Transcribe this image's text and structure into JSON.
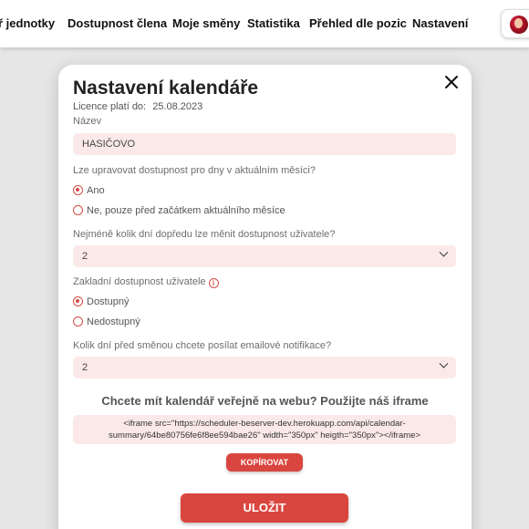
{
  "nav": {
    "items": [
      "ř jednotky",
      "Dostupnost člena",
      "Moje směny",
      "Statistika",
      "Přehled dle pozic",
      "Nastavení"
    ]
  },
  "modal": {
    "title": "Nastavení kalendáře",
    "license_label": "Licence platí do:",
    "license_date": "25.08.2023",
    "name_label": "Název",
    "name_value": "HASIČOVO",
    "q_current_month": "Lze upravovat dostupnost pro dny v aktuálním měsíci?",
    "opt_yes": "Ano",
    "opt_no_before": "Ne, pouze před začátkem aktuálního měsíce",
    "q_days_ahead": "Nejméně kolik dní dopředu lze měnit dostupnost uživatele?",
    "days_ahead_value": "2",
    "q_default_availability": "Zakladní dostupnost uživatele",
    "opt_available": "Dostupný",
    "opt_unavailable": "Nedostupný",
    "q_notification_days": "Kolik dní před směnou chcete posílat emailové notifikace?",
    "notification_days_value": "2",
    "iframe_title": "Chcete mít kalendář veřejně na webu? Použijte náš iframe",
    "iframe_code_line1": "<iframe src=\"https://scheduler-beserver-dev.herokuapp.com/api/calendar-",
    "iframe_code_line2": "summary/64be80756fe6f8ee594bae26\" width=\"350px\" heigth=\"350px\"></iframe>",
    "copy_label": "KOPÍROVAT",
    "save_label": "ULOŽIT"
  },
  "colors": {
    "accent": "#d9463f",
    "field_bg": "#fbe9e9"
  },
  "icons": [
    "close-icon",
    "chevron-down-icon",
    "info-icon",
    "avatar"
  ]
}
